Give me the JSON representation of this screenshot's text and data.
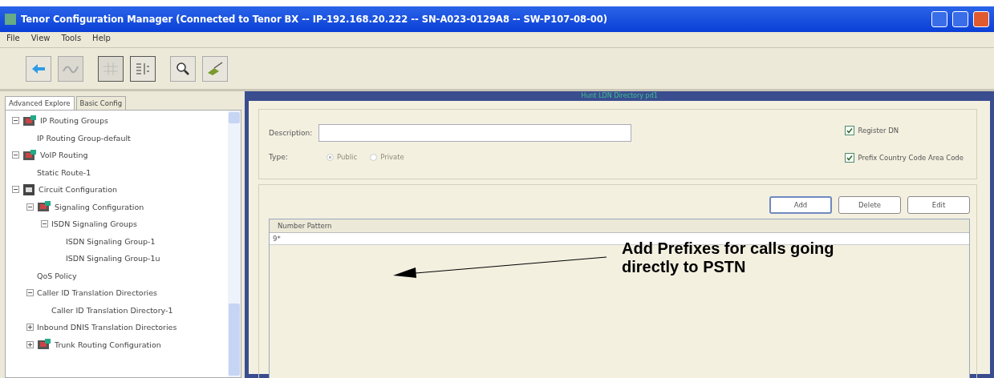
{
  "window": {
    "title": "Tenor Configuration Manager (Connected to Tenor BX -- IP-192.168.20.222 -- SN-A023-0129A8 -- SW-P107-08-00)"
  },
  "menu": [
    "File",
    "View",
    "Tools",
    "Help"
  ],
  "toolbar": [
    {
      "kind": "back",
      "disabled": false
    },
    {
      "kind": "wave",
      "disabled": true
    },
    {
      "kind": "grid",
      "disabled": true
    },
    {
      "kind": "list",
      "disabled": false
    },
    {
      "kind": "search",
      "disabled": false
    },
    {
      "kind": "brush",
      "disabled": false
    }
  ],
  "tabs": [
    {
      "label": "Advanced Explore",
      "selected": true
    },
    {
      "label": "Basic Config",
      "selected": false
    }
  ],
  "tree": [
    {
      "label": "IP Routing Groups",
      "kind": "node",
      "expanded": true,
      "children": [
        {
          "label": "IP Routing Group-default"
        }
      ]
    },
    {
      "label": "VoIP Routing",
      "kind": "node",
      "expanded": true,
      "children": [
        {
          "label": "Static Route-1"
        }
      ]
    },
    {
      "label": "Circuit Configuration",
      "kind": "root",
      "expanded": true,
      "children": [
        {
          "label": "Signaling Configuration",
          "kind": "node",
          "expanded": true,
          "children": [
            {
              "label": "ISDN Signaling Groups",
              "expanded": true,
              "children": [
                {
                  "label": "ISDN Signaling Group-1"
                },
                {
                  "label": "ISDN Signaling Group-1u"
                }
              ]
            }
          ]
        },
        {
          "label": "QoS Policy"
        },
        {
          "label": "Caller ID Translation Directories",
          "expanded": true,
          "children": [
            {
              "label": "Caller ID Translation Directory-1"
            }
          ]
        },
        {
          "label": "Inbound DNIS Translation Directories",
          "expanded": false
        },
        {
          "label": "Trunk Routing Configuration",
          "kind": "node",
          "expanded": false
        }
      ]
    }
  ],
  "panel": {
    "title": "Hunt LDN Directory pd1",
    "description": {
      "label": "Description:"
    },
    "type": {
      "label": "Type:",
      "options": [
        {
          "label": "Public",
          "selected": true,
          "disabled": true
        },
        {
          "label": "Private",
          "selected": false,
          "disabled": true
        }
      ]
    },
    "checkboxes": [
      {
        "label": "Register DN",
        "checked": true
      },
      {
        "label": "Prefix Country Code Area Code",
        "checked": true
      }
    ],
    "buttons": [
      {
        "label": "Add",
        "selected": true
      },
      {
        "label": "Delete",
        "selected": false
      },
      {
        "label": "Edit",
        "selected": false
      }
    ],
    "table": {
      "columns": [
        "Number Pattern"
      ],
      "rows": [
        [
          "9*"
        ]
      ]
    }
  },
  "annotation": {
    "text": "Add Prefixes for calls going directly to PSTN"
  }
}
